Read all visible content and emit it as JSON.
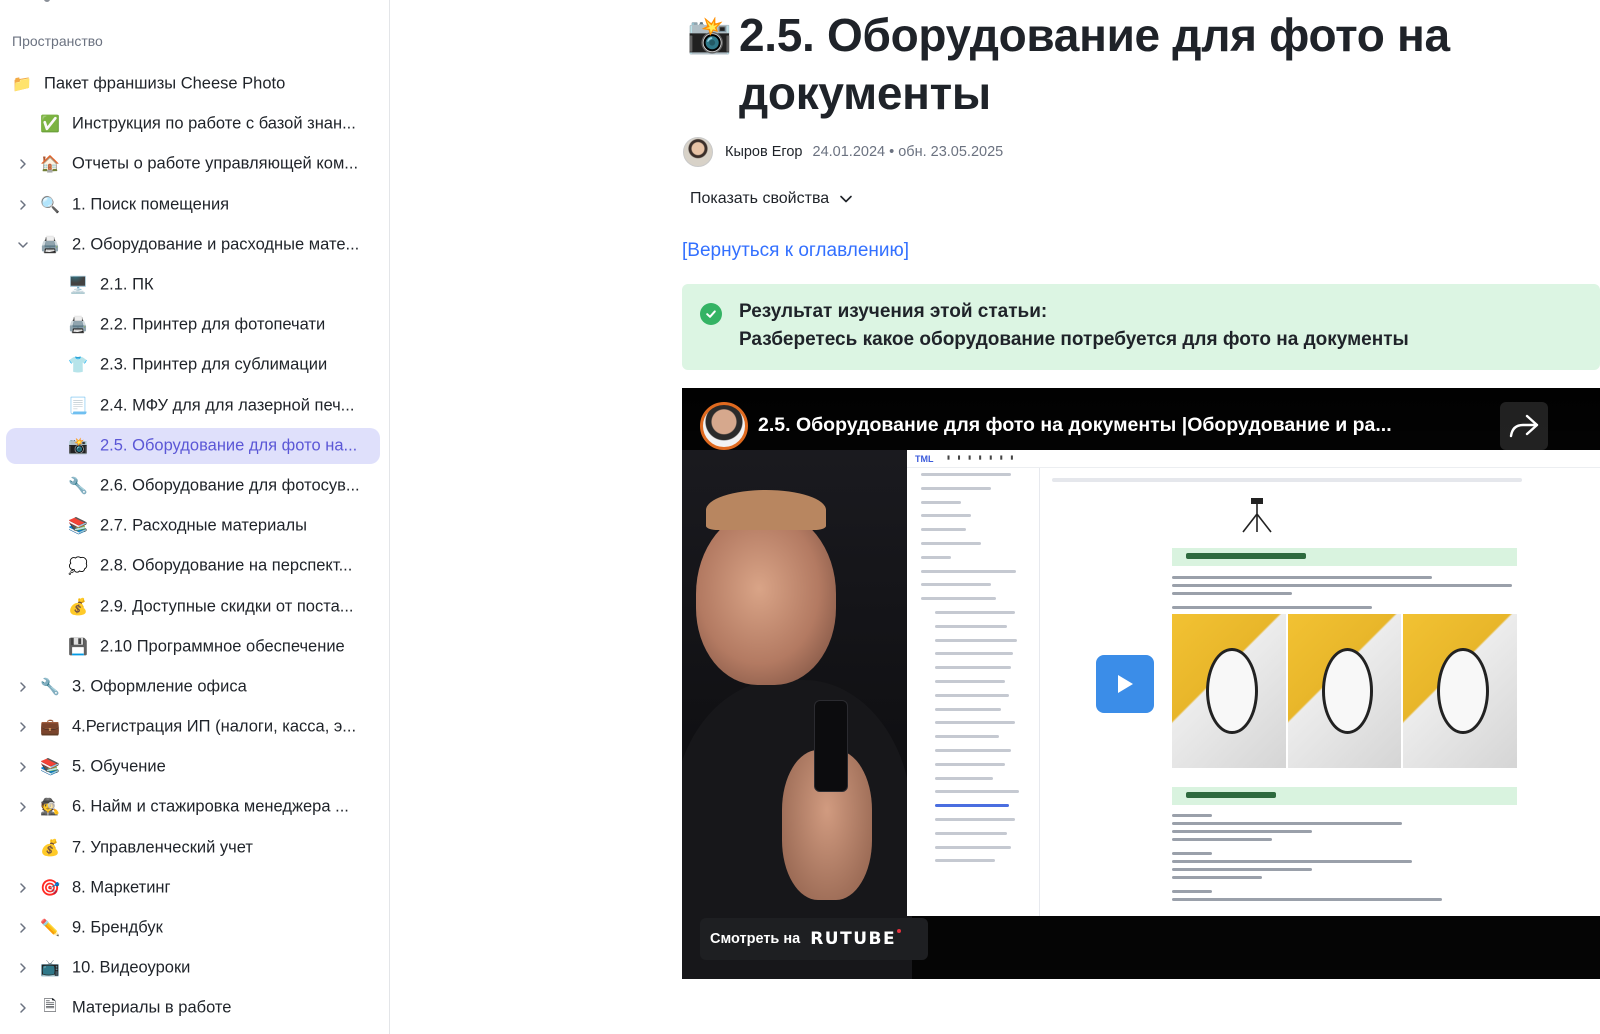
{
  "sidebar": {
    "section_label": "Пространство",
    "items": [
      {
        "label": "Пакет франшизы Cheese Photo",
        "icon": "folder-icon",
        "glyph": "📁",
        "level": 0,
        "chevron": "none"
      },
      {
        "label": "Инструкция по работе с базой знан...",
        "icon": "check-mark-icon",
        "glyph": "✅",
        "level": 1,
        "chevron": "none"
      },
      {
        "label": "Отчеты о работе управляющей ком...",
        "icon": "house-icon",
        "glyph": "🏠",
        "level": 1,
        "chevron": "collapsed"
      },
      {
        "label": "1. Поиск помещения",
        "icon": "magnifier-icon",
        "glyph": "🔍",
        "level": 1,
        "chevron": "collapsed"
      },
      {
        "label": "2. Оборудование и расходные мате...",
        "icon": "printer-icon",
        "glyph": "🖨️",
        "level": 1,
        "chevron": "expanded"
      },
      {
        "label": "2.1. ПК",
        "icon": "monitor-icon",
        "glyph": "🖥️",
        "level": 2,
        "chevron": "none"
      },
      {
        "label": "2.2. Принтер для фотопечати",
        "icon": "printer-icon",
        "glyph": "🖨️",
        "level": 2,
        "chevron": "none"
      },
      {
        "label": "2.3. Принтер для сублимации",
        "icon": "shirt-icon",
        "glyph": "👕",
        "level": 2,
        "chevron": "none"
      },
      {
        "label": "2.4. МФУ для для лазерной печ...",
        "icon": "scanner-icon",
        "glyph": "📃",
        "level": 2,
        "chevron": "none"
      },
      {
        "label": "2.5. Оборудование для фото на...",
        "icon": "camera-flash-icon",
        "glyph": "📸",
        "level": 2,
        "chevron": "none",
        "active": true
      },
      {
        "label": "2.6. Оборудование для фотосув...",
        "icon": "wrench-icon",
        "glyph": "🔧",
        "level": 2,
        "chevron": "none"
      },
      {
        "label": "2.7. Расходные материалы",
        "icon": "books-icon",
        "glyph": "📚",
        "level": 2,
        "chevron": "none"
      },
      {
        "label": "2.8. Оборудование на перспект...",
        "icon": "thought-bubble-icon",
        "glyph": "💭",
        "level": 2,
        "chevron": "none"
      },
      {
        "label": "2.9. Доступные скидки от поста...",
        "icon": "money-bag-icon",
        "glyph": "💰",
        "level": 2,
        "chevron": "none"
      },
      {
        "label": "2.10 Программное обеспечение",
        "icon": "floppy-disk-icon",
        "glyph": "💾",
        "level": 2,
        "chevron": "none"
      },
      {
        "label": "3. Оформление офиса",
        "icon": "wrench-icon",
        "glyph": "🔧",
        "level": 1,
        "chevron": "collapsed"
      },
      {
        "label": "4.Регистрация ИП (налоги, касса, э...",
        "icon": "briefcase-icon",
        "glyph": "💼",
        "level": 1,
        "chevron": "collapsed"
      },
      {
        "label": "5. Обучение",
        "icon": "books-icon",
        "glyph": "📚",
        "level": 1,
        "chevron": "collapsed"
      },
      {
        "label": "6. Найм и стажировка менеджера ...",
        "icon": "detective-icon",
        "glyph": "🕵️",
        "level": 1,
        "chevron": "collapsed"
      },
      {
        "label": "7. Управленческий учет",
        "icon": "money-bag-icon",
        "glyph": "💰",
        "level": 1,
        "chevron": "none"
      },
      {
        "label": "8. Маркетинг",
        "icon": "target-icon",
        "glyph": "🎯",
        "level": 1,
        "chevron": "collapsed"
      },
      {
        "label": "9. Брендбук",
        "icon": "pencil-icon",
        "glyph": "✏️",
        "level": 1,
        "chevron": "collapsed"
      },
      {
        "label": "10. Видеоуроки",
        "icon": "tv-icon",
        "glyph": "📺",
        "level": 1,
        "chevron": "collapsed"
      },
      {
        "label": "Материалы в работе",
        "icon": "document-icon",
        "glyph": "🗎",
        "level": 1,
        "chevron": "collapsed"
      }
    ]
  },
  "article": {
    "title_emoji": "📸",
    "title": "2.5. Оборудование для фото на документы",
    "author": "Кыров Егор",
    "dates": "24.01.2024 • обн. 23.05.2025",
    "show_properties": "Показать свойства",
    "back_link": "[Вернуться к оглавлению]",
    "callout": {
      "line1": "Результат изучения этой статьи:",
      "line2": "Разберетесь какое оборудование потребуется для фото на документы"
    }
  },
  "video": {
    "title": "2.5. Оборудование для фото на документы |Оборудование и ра...",
    "watch_label": "Смотреть на",
    "platform": "RUTUBE"
  },
  "colors": {
    "accent": "#5b57d6",
    "active_bg": "#dfe0fb",
    "link": "#3370ff",
    "callout_bg": "#dcf5e3",
    "callout_check": "#34b364",
    "play_button": "#3b8de8"
  }
}
